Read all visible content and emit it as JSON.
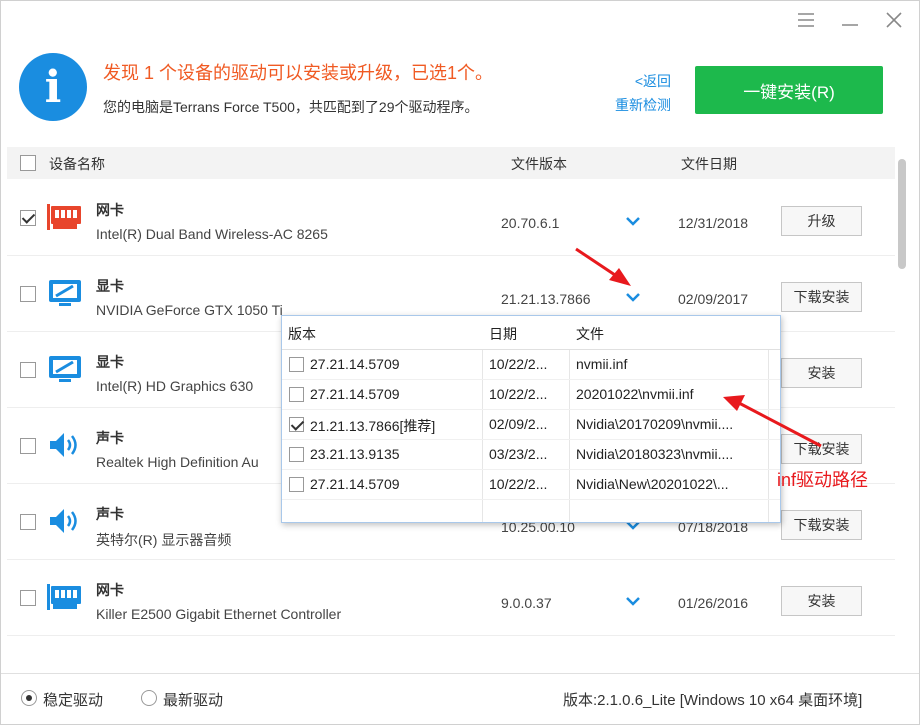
{
  "header": {
    "title": "发现 1 个设备的驱动可以安装或升级，已选1个。",
    "subtitle": "您的电脑是Terrans Force T500，共匹配到了29个驱动程序。",
    "back_link": "<返回",
    "redetect_link": "重新检测",
    "install_button": "一键安装(R)"
  },
  "table": {
    "col_name": "设备名称",
    "col_version": "文件版本",
    "col_date": "文件日期"
  },
  "devices": [
    {
      "type": "网卡",
      "name": "Intel(R) Dual Band Wireless-AC 8265",
      "version": "20.70.6.1",
      "date": "12/31/2018",
      "button": "升级",
      "checked": true,
      "icon": "network-card-icon",
      "icon_color": "#e8452c"
    },
    {
      "type": "显卡",
      "name": "NVIDIA GeForce GTX 1050 Ti",
      "version": "21.21.13.7866",
      "date": "02/09/2017",
      "button": "下载安装",
      "checked": false,
      "icon": "monitor-icon",
      "icon_color": "#1a8de0"
    },
    {
      "type": "显卡",
      "name": "Intel(R) HD Graphics 630",
      "version": "",
      "date": "",
      "button": "安装",
      "checked": false,
      "icon": "monitor-icon",
      "icon_color": "#1a8de0"
    },
    {
      "type": "声卡",
      "name": "Realtek High Definition Au",
      "version": "",
      "date": "",
      "button": "下载安装",
      "checked": false,
      "icon": "speaker-icon",
      "icon_color": "#1a8de0"
    },
    {
      "type": "声卡",
      "name": "英特尔(R) 显示器音频",
      "version": "10.25.00.10",
      "date": "07/18/2018",
      "button": "下载安装",
      "checked": false,
      "icon": "speaker-icon",
      "icon_color": "#1a8de0"
    },
    {
      "type": "网卡",
      "name": "Killer E2500 Gigabit Ethernet Controller",
      "version": "9.0.0.37",
      "date": "01/26/2016",
      "button": "安装",
      "checked": false,
      "icon": "network-card-icon",
      "icon_color": "#1a8de0"
    }
  ],
  "popup": {
    "col_version": "版本",
    "col_date": "日期",
    "col_file": "文件",
    "rows": [
      {
        "version": "27.21.14.5709",
        "date": "10/22/2...",
        "file": "nvmii.inf",
        "checked": false
      },
      {
        "version": "27.21.14.5709",
        "date": "10/22/2...",
        "file": "20201022\\nvmii.inf",
        "checked": false
      },
      {
        "version": "21.21.13.7866[推荐]",
        "date": "02/09/2...",
        "file": "Nvidia\\20170209\\nvmii....",
        "checked": true
      },
      {
        "version": "23.21.13.9135",
        "date": "03/23/2...",
        "file": "Nvidia\\20180323\\nvmii....",
        "checked": false
      },
      {
        "version": "27.21.14.5709",
        "date": "10/22/2...",
        "file": "Nvidia\\New\\20201022\\...",
        "checked": false
      }
    ]
  },
  "annotation": "inf驱动路径",
  "footer": {
    "stable_label": "稳定驱动",
    "latest_label": "最新驱动",
    "version_info": "版本:2.1.0.6_Lite [Windows 10 x64 桌面环境]"
  },
  "colors": {
    "accent_blue": "#1a8de0",
    "install_green": "#1db94c",
    "title_orange": "#f05a23",
    "annotation_red": "#e8191d"
  }
}
